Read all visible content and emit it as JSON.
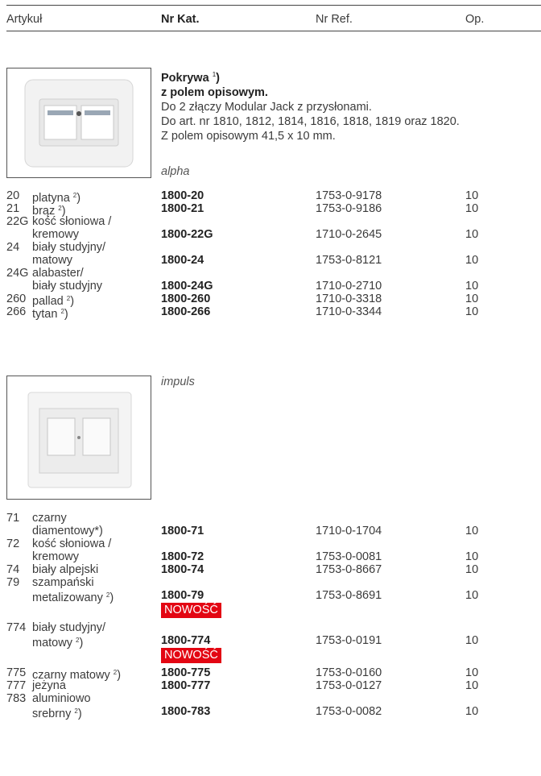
{
  "header": {
    "col_article": "Artykuł",
    "col_cat": "Nr Kat.",
    "col_ref": "Nr Ref.",
    "col_op": "Op."
  },
  "product": {
    "title": "Pokrywa",
    "title_note": "1",
    "subtitle": "z polem opisowym.",
    "lines": [
      "Do 2 złączy Modular Jack z przysłonami.",
      "Do art. nr 1810, 1812, 1814, 1816, 1818, 1819 oraz 1820.",
      "Z polem opisowym 41,5 x 10 mm."
    ]
  },
  "series_alpha": {
    "name": "alpha",
    "rows": [
      {
        "code": "20",
        "name": [
          "platyna"
        ],
        "note": "2",
        "cat": "1800-20",
        "ref": "1753-0-9178",
        "op": "10"
      },
      {
        "code": "21",
        "name": [
          "brąz"
        ],
        "note": "2",
        "cat": "1800-21",
        "ref": "1753-0-9186",
        "op": "10"
      },
      {
        "code": "22G",
        "name": [
          "kość słoniowa /",
          "kremowy"
        ],
        "note": "",
        "cat": "1800-22G",
        "ref": "1710-0-2645",
        "op": "10"
      },
      {
        "code": "24",
        "name": [
          "biały studyjny/",
          "matowy"
        ],
        "note": "",
        "cat": "1800-24",
        "ref": "1753-0-8121",
        "op": "10"
      },
      {
        "code": "24G",
        "name": [
          "alabaster/",
          "biały studyjny"
        ],
        "note": "",
        "cat": "1800-24G",
        "ref": "1710-0-2710",
        "op": "10"
      },
      {
        "code": "260",
        "name": [
          "pallad"
        ],
        "note": "2",
        "cat": "1800-260",
        "ref": "1710-0-3318",
        "op": "10"
      },
      {
        "code": "266",
        "name": [
          "tytan"
        ],
        "note": "2",
        "cat": "1800-266",
        "ref": "1710-0-3344",
        "op": "10"
      }
    ]
  },
  "series_impuls": {
    "name": "impuls",
    "rows": [
      {
        "code": "71",
        "name": [
          "czarny",
          "diamentowy*)"
        ],
        "note": "",
        "cat": "1800-71",
        "ref": "1710-0-1704",
        "op": "10"
      },
      {
        "code": "72",
        "name": [
          "kość słoniowa /",
          "kremowy"
        ],
        "note": "",
        "cat": "1800-72",
        "ref": "1753-0-0081",
        "op": "10"
      },
      {
        "code": "74",
        "name": [
          "biały alpejski"
        ],
        "note": "",
        "cat": "1800-74",
        "ref": "1753-0-8667",
        "op": "10"
      },
      {
        "code": "79",
        "name": [
          "szampański",
          "metalizowany"
        ],
        "note": "2",
        "cat": "1800-79",
        "ref": "1753-0-8691",
        "op": "10",
        "badge": "NOWOŚĆ"
      },
      {
        "code": "774",
        "name": [
          "biały studyjny/",
          "matowy"
        ],
        "note": "2",
        "cat": "1800-774",
        "ref": "1753-0-0191",
        "op": "10",
        "badge": "NOWOŚĆ"
      },
      {
        "code": "775",
        "name": [
          "czarny matowy"
        ],
        "note": "2",
        "cat": "1800-775",
        "ref": "1753-0-0160",
        "op": "10"
      },
      {
        "code": "777",
        "name": [
          "jeżyna"
        ],
        "note": "",
        "cat": "1800-777",
        "ref": "1753-0-0127",
        "op": "10"
      },
      {
        "code": "783",
        "name": [
          "aluminiowo",
          "srebrny"
        ],
        "note": "2",
        "cat": "1800-783",
        "ref": "1753-0-0082",
        "op": "10"
      }
    ]
  },
  "colors": {
    "badge": "#e30613",
    "text": "#3b3b3b"
  }
}
